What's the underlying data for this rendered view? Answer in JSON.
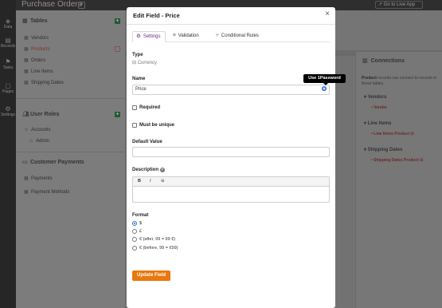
{
  "app": {
    "title": "Purchase Orders",
    "live_link": "Go to Live App",
    "rail": [
      {
        "label": "Data",
        "icon": "database-icon"
      },
      {
        "label": "Records",
        "icon": "records-icon"
      },
      {
        "label": "Tasks",
        "icon": "tasks-icon"
      },
      {
        "label": "Pages",
        "icon": "pages-icon"
      },
      {
        "label": "Settings",
        "icon": "gear-icon"
      }
    ]
  },
  "sidebar": {
    "tables_heading": "Tables",
    "tables": [
      {
        "label": "Vendors",
        "active": false
      },
      {
        "label": "Products",
        "active": true
      },
      {
        "label": "Orders",
        "active": false
      },
      {
        "label": "Line Items",
        "active": false
      },
      {
        "label": "Shipping Dates",
        "active": false
      }
    ],
    "roles_heading": "User Roles",
    "roles": [
      {
        "label": "Accounts"
      },
      {
        "label": "Admin"
      }
    ],
    "payments_heading": "Customer Payments",
    "payments": [
      {
        "label": "Payments"
      },
      {
        "label": "Payment Methods"
      }
    ]
  },
  "connections": {
    "heading": "Connections",
    "description_bold": "Product",
    "description_rest": " records can connect to records in these tables.",
    "groups": [
      {
        "label": "Vendors",
        "item": "Vendor"
      },
      {
        "label": "Line Items",
        "item": "Line Items Product"
      },
      {
        "label": "Shipping Dates",
        "item": "Shipping Dates Product"
      }
    ]
  },
  "modal": {
    "title": "Edit Field - Price",
    "close": "×",
    "tabs": [
      {
        "label": "Settings",
        "icon": "gear-icon",
        "active": true
      },
      {
        "label": "Validation",
        "icon": "checklist-icon",
        "active": false
      },
      {
        "label": "Conditional Rules",
        "icon": "branch-icon",
        "active": false
      }
    ],
    "type_label": "Type",
    "type_value": "Currency",
    "name_label": "Name",
    "name_value": "Price",
    "tooltip": "Use 1Password",
    "required_label": "Required",
    "unique_label": "Must be unique",
    "default_label": "Default Value",
    "default_value": "",
    "description_label": "Description",
    "toolbar": {
      "bold": "B",
      "italic": "I",
      "link": "⊖"
    },
    "format_label": "Format",
    "formats": [
      {
        "label": "$",
        "selected": true
      },
      {
        "label": "£",
        "selected": false
      },
      {
        "label": "€ (after, 99 = 99 €)",
        "selected": false
      },
      {
        "label": "€ (before, 99 = €99)",
        "selected": false
      }
    ],
    "submit": "Update Field"
  }
}
